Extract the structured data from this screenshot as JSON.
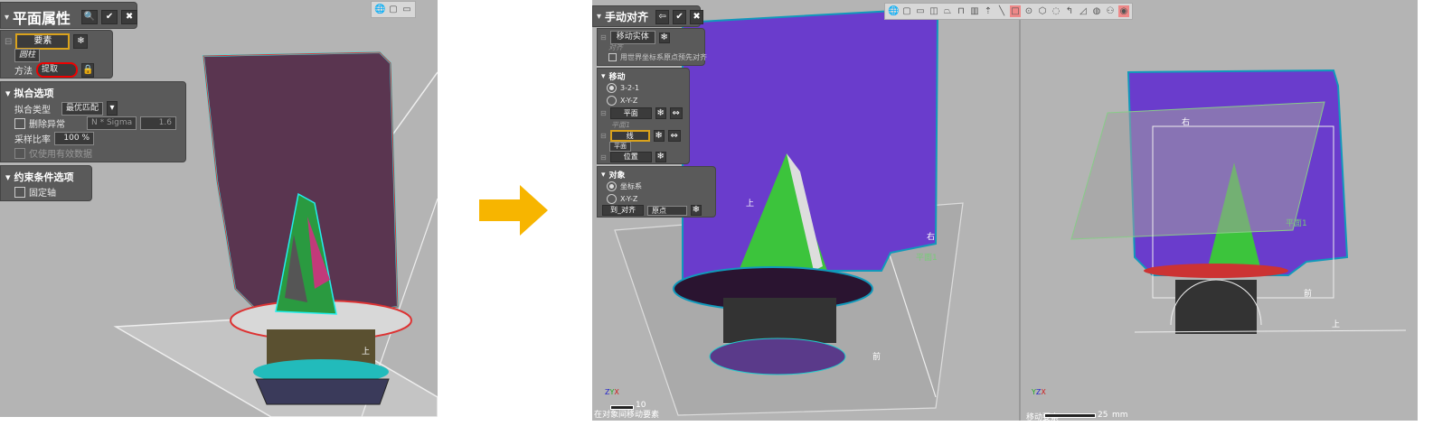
{
  "left": {
    "panel_title": "平面属性",
    "element_label": "要素",
    "element_sub": "圆柱",
    "method_label": "方法",
    "method_value": "提取",
    "fit_section": "拟合选项",
    "fit_type_label": "拟合类型",
    "fit_type_value": "最优匹配",
    "remove_outliers": "删除异常",
    "sigma_value": "N * Sigma",
    "sigma_number": "1.6",
    "sampling_label": "采样比率",
    "sampling_value": "100 %",
    "valid_only": "仅使用有效数据",
    "constraint_section": "约束条件选项",
    "fixed_axis": "固定轴",
    "view_label_up": "上"
  },
  "right": {
    "panel_title": "手动对齐",
    "move_body": "移动实体",
    "align_label": "对齐",
    "prealign": "用世界坐标系原点预先对齐",
    "move_section": "移动",
    "opt_321": "3-2-1",
    "opt_xyz": "X-Y-Z",
    "plane_label": "平面",
    "plane_sub": "平面1",
    "line_label": "线",
    "line_sub": "平面",
    "position_label": "位置",
    "target_section": "对象",
    "target_cs": "坐标系",
    "target_xyz": "X-Y-Z",
    "to_align": "到_对齐",
    "origin_value": "原点",
    "view_labels": {
      "up": "上",
      "front": "前",
      "right": "右",
      "plane1": "平面1"
    },
    "status_left": "在对象间移动要素",
    "scale_left": "10",
    "status_right": "移动要素",
    "scale_right": "25",
    "unit": "mm"
  }
}
